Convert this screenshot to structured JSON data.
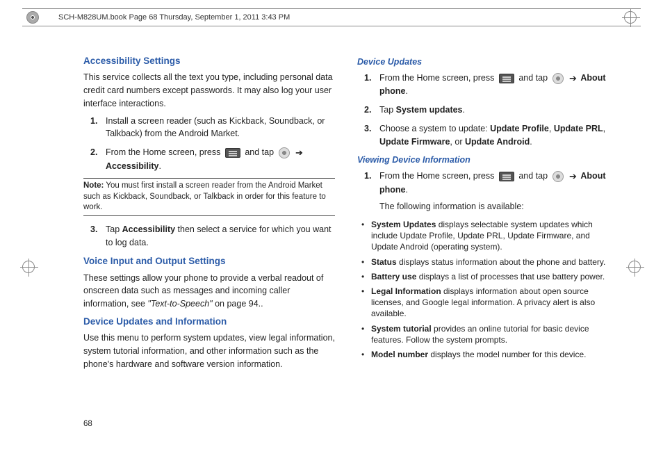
{
  "header": {
    "text": "SCH-M828UM.book  Page 68  Thursday, September 1, 2011  3:43 PM"
  },
  "page_number": "68",
  "left": {
    "h1": "Accessibility Settings",
    "p1": "This service collects all the text you type, including personal data credit card numbers except passwords. It may also log your user interface interactions.",
    "s1": {
      "num": "1.",
      "text": "Install a screen reader (such as Kickback, Soundback, or Talkback) from the Android Market."
    },
    "s2": {
      "num": "2.",
      "pre": "From the Home screen, press",
      "mid": "and tap",
      "arrow": "➔",
      "tail": "Accessibility",
      "period": "."
    },
    "note_label": "Note:",
    "note_text": " You must first install a screen reader from the Android Market such as Kickback, Soundback, or Talkback in order for this feature to work.",
    "s3": {
      "num": "3.",
      "pre": "Tap ",
      "b": "Accessibility",
      "post": " then select a service for which you want to log data."
    },
    "h2": "Voice Input and Output Settings",
    "p2a": "These settings allow your phone to provide a verbal readout of onscreen data such as messages and incoming caller information, see ",
    "p2i": "\"Text-to-Speech\"",
    "p2b": " on page 94..",
    "h3": "Device Updates and Information",
    "p3": "Use this menu to perform system updates, view legal information, system tutorial information, and other information such as the phone's hardware and software version information."
  },
  "right": {
    "h1": "Device Updates",
    "d1": {
      "num": "1.",
      "pre": "From the Home screen, press",
      "mid": "and tap",
      "arrow": "➔",
      "tail": "About phone",
      "period": "."
    },
    "d2": {
      "num": "2.",
      "pre": "Tap ",
      "b": "System updates",
      "period": "."
    },
    "d3": {
      "num": "3.",
      "pre": "Choose a system to update: ",
      "b1": "Update Profile",
      "c1": ", ",
      "b2": "Update PRL",
      "c2": ", ",
      "b3": "Update Firmware",
      "c3": ", or ",
      "b4": "Update Android",
      "period": "."
    },
    "h2": "Viewing Device Information",
    "v1": {
      "num": "1.",
      "pre": "From the Home screen, press",
      "mid": "and tap",
      "arrow": "➔",
      "tail": "About phone",
      "period": "."
    },
    "v1b": "The following information is available:",
    "bullets": [
      {
        "b": "System Updates",
        "t": " displays selectable system updates which include Update Profile, Update PRL, Update Firmware, and Update Android (operating system)."
      },
      {
        "b": "Status",
        "t": " displays status information about the phone and battery."
      },
      {
        "b": "Battery use",
        "t": " displays a list of processes that use battery power."
      },
      {
        "b": "Legal Information",
        "t": " displays information about open source licenses, and Google legal information. A privacy alert is also available."
      },
      {
        "b": "System tutorial",
        "t": " provides an online tutorial for basic device features. Follow the system prompts."
      },
      {
        "b": "Model number",
        "t": " displays the model number for this device."
      }
    ]
  }
}
